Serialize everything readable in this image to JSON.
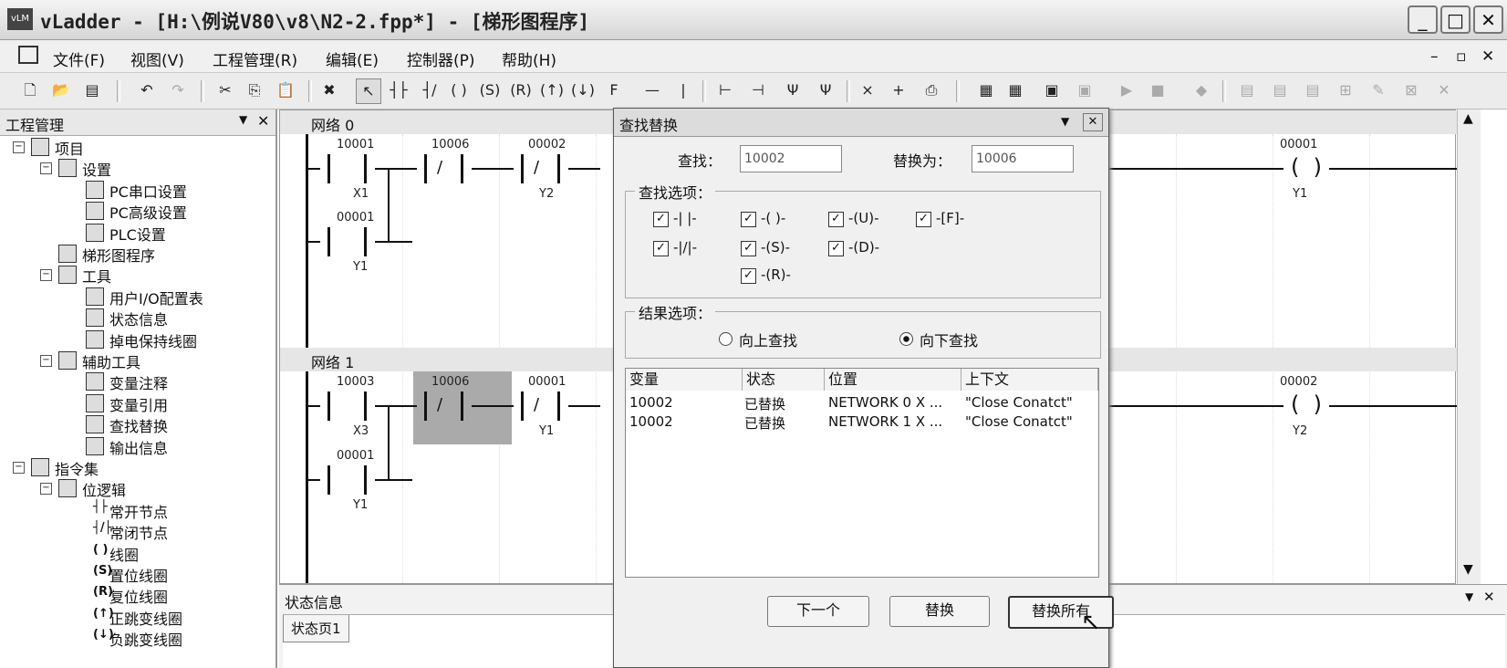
{
  "window": {
    "title": "vLadder - [H:\\例说V80\\v8\\N2-2.fpp*] - [梯形图程序]",
    "icon_label": "vLM"
  },
  "menu": [
    "文件(F)",
    "视图(V)",
    "工程管理(R)",
    "编辑(E)",
    "控制器(P)",
    "帮助(H)"
  ],
  "mdi_controls": [
    "–",
    "▫",
    "✕"
  ],
  "left_panel": {
    "title": "工程管理",
    "tree": [
      {
        "label": "项目",
        "level": 0
      },
      {
        "label": "设置",
        "level": 1
      },
      {
        "label": "PC串口设置",
        "level": 2
      },
      {
        "label": "PC高级设置",
        "level": 2
      },
      {
        "label": "PLC设置",
        "level": 2
      },
      {
        "label": "梯形图程序",
        "level": 1
      },
      {
        "label": "工具",
        "level": 1
      },
      {
        "label": "用户I/O配置表",
        "level": 2
      },
      {
        "label": "状态信息",
        "level": 2
      },
      {
        "label": "掉电保持线圈",
        "level": 2
      },
      {
        "label": "辅助工具",
        "level": 1
      },
      {
        "label": "变量注释",
        "level": 2
      },
      {
        "label": "变量引用",
        "level": 2
      },
      {
        "label": "查找替换",
        "level": 2
      },
      {
        "label": "输出信息",
        "level": 2
      },
      {
        "label": "指令集",
        "level": 0
      },
      {
        "label": "位逻辑",
        "level": 1
      },
      {
        "label": "常开节点",
        "level": 2
      },
      {
        "label": "常闭节点",
        "level": 2
      },
      {
        "label": "线圈",
        "level": 2
      },
      {
        "label": "置位线圈",
        "level": 2
      },
      {
        "label": "复位线圈",
        "level": 2
      },
      {
        "label": "正跳变线圈",
        "level": 2
      },
      {
        "label": "负跳变线圈",
        "level": 2
      }
    ],
    "instr_glyphs": [
      "┤├",
      "┤/├",
      "( )",
      "(S)",
      "(R)",
      "(↑)",
      "(↓)"
    ]
  },
  "ladder": {
    "networks": [
      {
        "header": "网络 0",
        "contacts": [
          {
            "top": "10001",
            "bottom": "X1"
          },
          {
            "top": "10006",
            "bottom": ""
          },
          {
            "top": "00002",
            "bottom": "Y2"
          },
          {
            "top": "00001",
            "bottom": "Y1"
          }
        ],
        "coil": {
          "top": "00001",
          "bottom": "Y1"
        }
      },
      {
        "header": "网络 1",
        "contacts": [
          {
            "top": "10003",
            "bottom": "X3"
          },
          {
            "top": "10006",
            "bottom": ""
          },
          {
            "top": "00001",
            "bottom": "Y1"
          },
          {
            "top": "00001",
            "bottom": "Y1"
          }
        ],
        "coil": {
          "top": "00002",
          "bottom": "Y2"
        }
      }
    ]
  },
  "status_panel": {
    "title": "状态信息",
    "tab": "状态页1"
  },
  "dialog": {
    "title": "查找替换",
    "find_label": "查找：",
    "find_value": "10002",
    "replace_label": "替换为：",
    "replace_value": "10006",
    "find_options_label": "查找选项：",
    "options": [
      "-| |-",
      "-|/|-",
      "-( )-",
      "-(S)-",
      "-(R)-",
      "-(U)-",
      "-(D)-",
      "-[F]-"
    ],
    "result_options_label": "结果选项：",
    "radio_up": "向上查找",
    "radio_down": "向下查找",
    "columns": [
      "变量",
      "状态",
      "位置",
      "上下文"
    ],
    "rows": [
      [
        "10002",
        "已替换",
        "NETWORK 0  X ...",
        "\"Close Conatct\""
      ],
      [
        "10002",
        "已替换",
        "NETWORK 1  X ...",
        "\"Close Conatct\""
      ]
    ],
    "buttons": [
      "下一个",
      "替换",
      "替换所有"
    ]
  }
}
